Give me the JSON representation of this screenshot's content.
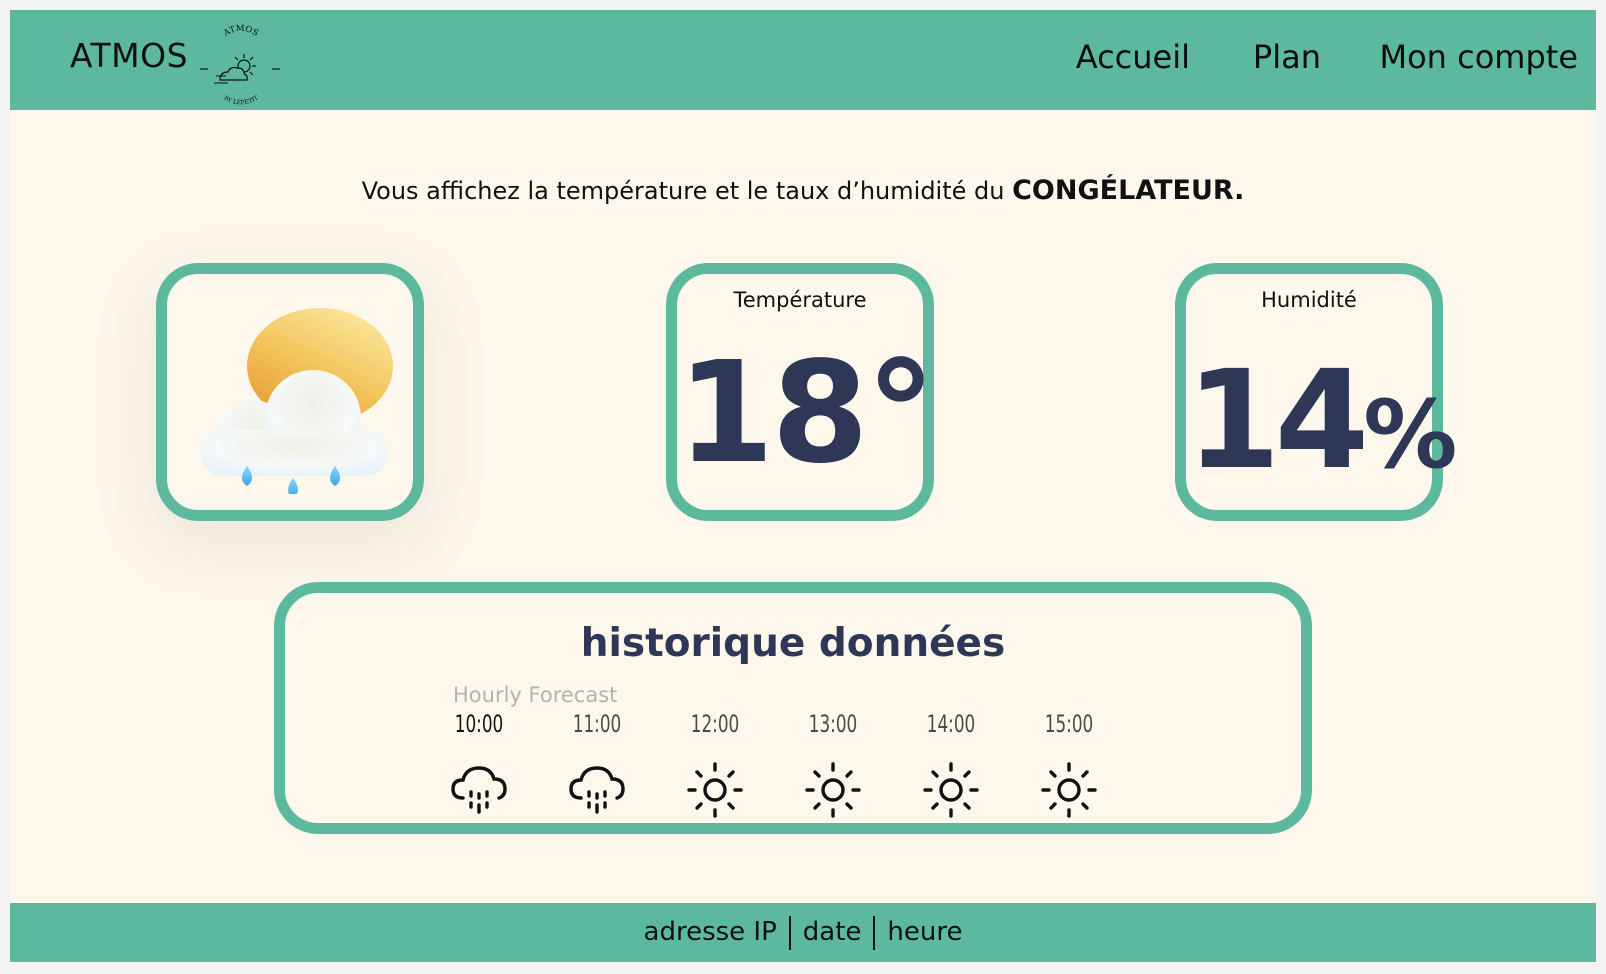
{
  "header": {
    "brand": "ATMOS",
    "logo": {
      "arc_top": "ATMOS",
      "arc_bottom": "BY LEPETIT"
    },
    "nav": [
      {
        "label": "Accueil"
      },
      {
        "label": "Plan"
      },
      {
        "label": "Mon compte"
      }
    ]
  },
  "intro": {
    "text": "Vous affichez la température et le taux d’humidité du ",
    "location": "CONGÉLATEUR."
  },
  "cards": {
    "weather": {
      "icon": "sun-cloud-rain-icon"
    },
    "temperature": {
      "label": "Température",
      "value": "18°"
    },
    "humidity": {
      "label": "Humidité",
      "value": "14",
      "unit": "%"
    }
  },
  "history": {
    "title": "historique données",
    "forecast_label": "Hourly Forecast",
    "hours": [
      {
        "time": "10:00",
        "icon": "rain-cloud-icon"
      },
      {
        "time": "11:00",
        "icon": "rain-cloud-icon"
      },
      {
        "time": "12:00",
        "icon": "sun-icon"
      },
      {
        "time": "13:00",
        "icon": "sun-icon"
      },
      {
        "time": "14:00",
        "icon": "sun-icon"
      },
      {
        "time": "15:00",
        "icon": "sun-icon"
      }
    ]
  },
  "footer": {
    "ip": "adresse IP",
    "date": "date",
    "time": "heure"
  },
  "colors": {
    "accent": "#5cb99d",
    "background": "#fdf7ec",
    "value_text": "#2e3856"
  }
}
